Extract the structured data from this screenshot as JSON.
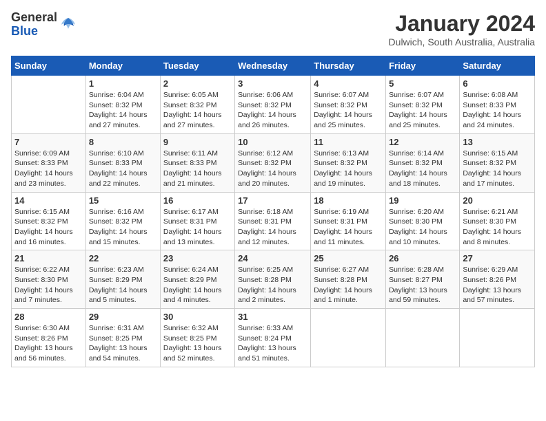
{
  "header": {
    "logo_general": "General",
    "logo_blue": "Blue",
    "month_title": "January 2024",
    "location": "Dulwich, South Australia, Australia"
  },
  "weekdays": [
    "Sunday",
    "Monday",
    "Tuesday",
    "Wednesday",
    "Thursday",
    "Friday",
    "Saturday"
  ],
  "weeks": [
    [
      {
        "day": "",
        "sunrise": "",
        "sunset": "",
        "daylight": ""
      },
      {
        "day": "1",
        "sunrise": "Sunrise: 6:04 AM",
        "sunset": "Sunset: 8:32 PM",
        "daylight": "Daylight: 14 hours and 27 minutes."
      },
      {
        "day": "2",
        "sunrise": "Sunrise: 6:05 AM",
        "sunset": "Sunset: 8:32 PM",
        "daylight": "Daylight: 14 hours and 27 minutes."
      },
      {
        "day": "3",
        "sunrise": "Sunrise: 6:06 AM",
        "sunset": "Sunset: 8:32 PM",
        "daylight": "Daylight: 14 hours and 26 minutes."
      },
      {
        "day": "4",
        "sunrise": "Sunrise: 6:07 AM",
        "sunset": "Sunset: 8:32 PM",
        "daylight": "Daylight: 14 hours and 25 minutes."
      },
      {
        "day": "5",
        "sunrise": "Sunrise: 6:07 AM",
        "sunset": "Sunset: 8:32 PM",
        "daylight": "Daylight: 14 hours and 25 minutes."
      },
      {
        "day": "6",
        "sunrise": "Sunrise: 6:08 AM",
        "sunset": "Sunset: 8:33 PM",
        "daylight": "Daylight: 14 hours and 24 minutes."
      }
    ],
    [
      {
        "day": "7",
        "sunrise": "Sunrise: 6:09 AM",
        "sunset": "Sunset: 8:33 PM",
        "daylight": "Daylight: 14 hours and 23 minutes."
      },
      {
        "day": "8",
        "sunrise": "Sunrise: 6:10 AM",
        "sunset": "Sunset: 8:33 PM",
        "daylight": "Daylight: 14 hours and 22 minutes."
      },
      {
        "day": "9",
        "sunrise": "Sunrise: 6:11 AM",
        "sunset": "Sunset: 8:33 PM",
        "daylight": "Daylight: 14 hours and 21 minutes."
      },
      {
        "day": "10",
        "sunrise": "Sunrise: 6:12 AM",
        "sunset": "Sunset: 8:32 PM",
        "daylight": "Daylight: 14 hours and 20 minutes."
      },
      {
        "day": "11",
        "sunrise": "Sunrise: 6:13 AM",
        "sunset": "Sunset: 8:32 PM",
        "daylight": "Daylight: 14 hours and 19 minutes."
      },
      {
        "day": "12",
        "sunrise": "Sunrise: 6:14 AM",
        "sunset": "Sunset: 8:32 PM",
        "daylight": "Daylight: 14 hours and 18 minutes."
      },
      {
        "day": "13",
        "sunrise": "Sunrise: 6:15 AM",
        "sunset": "Sunset: 8:32 PM",
        "daylight": "Daylight: 14 hours and 17 minutes."
      }
    ],
    [
      {
        "day": "14",
        "sunrise": "Sunrise: 6:15 AM",
        "sunset": "Sunset: 8:32 PM",
        "daylight": "Daylight: 14 hours and 16 minutes."
      },
      {
        "day": "15",
        "sunrise": "Sunrise: 6:16 AM",
        "sunset": "Sunset: 8:32 PM",
        "daylight": "Daylight: 14 hours and 15 minutes."
      },
      {
        "day": "16",
        "sunrise": "Sunrise: 6:17 AM",
        "sunset": "Sunset: 8:31 PM",
        "daylight": "Daylight: 14 hours and 13 minutes."
      },
      {
        "day": "17",
        "sunrise": "Sunrise: 6:18 AM",
        "sunset": "Sunset: 8:31 PM",
        "daylight": "Daylight: 14 hours and 12 minutes."
      },
      {
        "day": "18",
        "sunrise": "Sunrise: 6:19 AM",
        "sunset": "Sunset: 8:31 PM",
        "daylight": "Daylight: 14 hours and 11 minutes."
      },
      {
        "day": "19",
        "sunrise": "Sunrise: 6:20 AM",
        "sunset": "Sunset: 8:30 PM",
        "daylight": "Daylight: 14 hours and 10 minutes."
      },
      {
        "day": "20",
        "sunrise": "Sunrise: 6:21 AM",
        "sunset": "Sunset: 8:30 PM",
        "daylight": "Daylight: 14 hours and 8 minutes."
      }
    ],
    [
      {
        "day": "21",
        "sunrise": "Sunrise: 6:22 AM",
        "sunset": "Sunset: 8:30 PM",
        "daylight": "Daylight: 14 hours and 7 minutes."
      },
      {
        "day": "22",
        "sunrise": "Sunrise: 6:23 AM",
        "sunset": "Sunset: 8:29 PM",
        "daylight": "Daylight: 14 hours and 5 minutes."
      },
      {
        "day": "23",
        "sunrise": "Sunrise: 6:24 AM",
        "sunset": "Sunset: 8:29 PM",
        "daylight": "Daylight: 14 hours and 4 minutes."
      },
      {
        "day": "24",
        "sunrise": "Sunrise: 6:25 AM",
        "sunset": "Sunset: 8:28 PM",
        "daylight": "Daylight: 14 hours and 2 minutes."
      },
      {
        "day": "25",
        "sunrise": "Sunrise: 6:27 AM",
        "sunset": "Sunset: 8:28 PM",
        "daylight": "Daylight: 14 hours and 1 minute."
      },
      {
        "day": "26",
        "sunrise": "Sunrise: 6:28 AM",
        "sunset": "Sunset: 8:27 PM",
        "daylight": "Daylight: 13 hours and 59 minutes."
      },
      {
        "day": "27",
        "sunrise": "Sunrise: 6:29 AM",
        "sunset": "Sunset: 8:26 PM",
        "daylight": "Daylight: 13 hours and 57 minutes."
      }
    ],
    [
      {
        "day": "28",
        "sunrise": "Sunrise: 6:30 AM",
        "sunset": "Sunset: 8:26 PM",
        "daylight": "Daylight: 13 hours and 56 minutes."
      },
      {
        "day": "29",
        "sunrise": "Sunrise: 6:31 AM",
        "sunset": "Sunset: 8:25 PM",
        "daylight": "Daylight: 13 hours and 54 minutes."
      },
      {
        "day": "30",
        "sunrise": "Sunrise: 6:32 AM",
        "sunset": "Sunset: 8:25 PM",
        "daylight": "Daylight: 13 hours and 52 minutes."
      },
      {
        "day": "31",
        "sunrise": "Sunrise: 6:33 AM",
        "sunset": "Sunset: 8:24 PM",
        "daylight": "Daylight: 13 hours and 51 minutes."
      },
      {
        "day": "",
        "sunrise": "",
        "sunset": "",
        "daylight": ""
      },
      {
        "day": "",
        "sunrise": "",
        "sunset": "",
        "daylight": ""
      },
      {
        "day": "",
        "sunrise": "",
        "sunset": "",
        "daylight": ""
      }
    ]
  ]
}
